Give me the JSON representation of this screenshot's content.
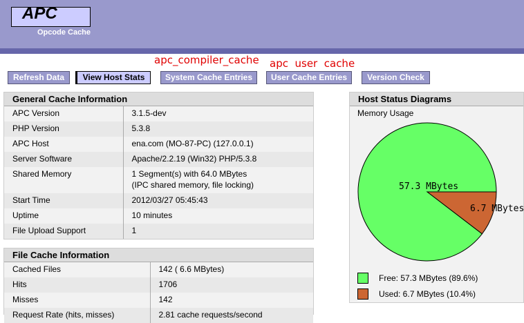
{
  "header": {
    "logo": "APC",
    "subtitle": "Opcode Cache"
  },
  "annotations": {
    "compiler": "apc_compiler_cache",
    "user": "apc  user  cache"
  },
  "tabs": [
    {
      "label": "Refresh Data",
      "active": false
    },
    {
      "label": "View Host Stats",
      "active": true
    },
    {
      "label": "System Cache Entries",
      "active": false
    },
    {
      "label": "User Cache Entries",
      "active": false
    },
    {
      "label": "Version Check",
      "active": false
    }
  ],
  "general": {
    "title": "General Cache Information",
    "rows": [
      {
        "label": "APC Version",
        "value": "3.1.5-dev"
      },
      {
        "label": "PHP Version",
        "value": "5.3.8"
      },
      {
        "label": "APC Host",
        "value": "ena.com (MO-87-PC) (127.0.0.1)"
      },
      {
        "label": "Server Software",
        "value": "Apache/2.2.19 (Win32) PHP/5.3.8"
      },
      {
        "label": "Shared Memory",
        "value": "1 Segment(s) with 64.0 MBytes",
        "value2": "(IPC shared memory, file locking)"
      },
      {
        "label": "Start Time",
        "value": "2012/03/27 05:45:43"
      },
      {
        "label": "Uptime",
        "value": "10 minutes"
      },
      {
        "label": "File Upload Support",
        "value": "1"
      }
    ]
  },
  "file": {
    "title": "File Cache Information",
    "rows": [
      {
        "label": "Cached Files",
        "value": "142 ( 6.6 MBytes)"
      },
      {
        "label": "Hits",
        "value": "1706"
      },
      {
        "label": "Misses",
        "value": "142"
      },
      {
        "label": "Request Rate (hits, misses)",
        "value": "2.81 cache requests/second"
      }
    ]
  },
  "host": {
    "title": "Host Status Diagrams",
    "memory_label": "Memory Usage",
    "free_label": "57.3 MBytes",
    "used_label": "6.7 MBytes",
    "legend_free": "Free: 57.3 MBytes (89.6%)",
    "legend_used": "Used: 6.7 MBytes (10.4%)",
    "free_fraction": 0.896,
    "used_fraction": 0.104,
    "free_color": "#66ff66",
    "used_color": "#cc6633"
  },
  "colors": {
    "header": "#9999cc",
    "header_bar": "#6666aa",
    "logo_bg": "#ccccff",
    "annotation": "#e00000"
  }
}
